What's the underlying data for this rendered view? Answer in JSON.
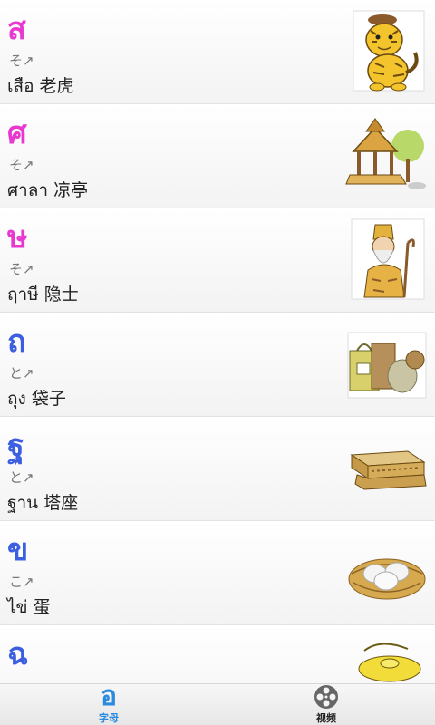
{
  "colors": {
    "pink": "#e838d0",
    "blue": "#3b5fe0",
    "tab_active": "#2a8adf"
  },
  "list": [
    {
      "letter": "ส",
      "letter_color": "#e838d0",
      "pron": "そ↗",
      "word": "เสือ 老虎",
      "icon": "tiger-icon"
    },
    {
      "letter": "ศ",
      "letter_color": "#e838d0",
      "pron": "そ↗",
      "word": "ศาลา 凉亭",
      "icon": "pavilion-icon"
    },
    {
      "letter": "ษ",
      "letter_color": "#e838d0",
      "pron": "そ↗",
      "word": "ฤาษี 隐士",
      "icon": "hermit-icon"
    },
    {
      "letter": "ถ",
      "letter_color": "#3b5fe0",
      "pron": "と↗",
      "word": "ถุง 袋子",
      "icon": "bags-icon"
    },
    {
      "letter": "ฐ",
      "letter_color": "#3b5fe0",
      "pron": "と↗",
      "word": "ฐาน 塔座",
      "icon": "pedestal-icon"
    },
    {
      "letter": "ข",
      "letter_color": "#3b5fe0",
      "pron": "こ↗",
      "word": "ไข่ 蛋",
      "icon": "eggs-nest-icon"
    },
    {
      "letter": "ฉ",
      "letter_color": "#3b5fe0",
      "pron": "",
      "word": "",
      "icon": "cymbal-icon"
    }
  ],
  "tabs": [
    {
      "label": "字母",
      "glyph": "อ",
      "active": true,
      "icon": "letter-tab-icon"
    },
    {
      "label": "视频",
      "active": false,
      "icon": "film-reel-icon"
    }
  ]
}
